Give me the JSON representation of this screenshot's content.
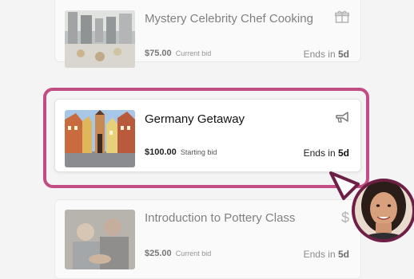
{
  "auction_items": [
    {
      "title": "Mystery Celebrity Chef Cooking",
      "amount": "$75.00",
      "bid_label": "Current bid",
      "ends_prefix": "Ends in",
      "ends_value": "5d",
      "icon": "gift-icon"
    },
    {
      "title": "Germany Getaway",
      "amount": "$100.00",
      "bid_label": "Starting bid",
      "ends_prefix": "Ends in",
      "ends_value": "5d",
      "icon": "megaphone-icon"
    },
    {
      "title": "Introduction to Pottery Class",
      "amount": "$25.00",
      "bid_label": "Current bid",
      "ends_prefix": "Ends in",
      "ends_value": "5d",
      "icon": "dollar-icon",
      "icon_glyph": "$"
    }
  ],
  "colors": {
    "highlight": "#c24d85",
    "avatar_ring": "#6e1f45"
  }
}
